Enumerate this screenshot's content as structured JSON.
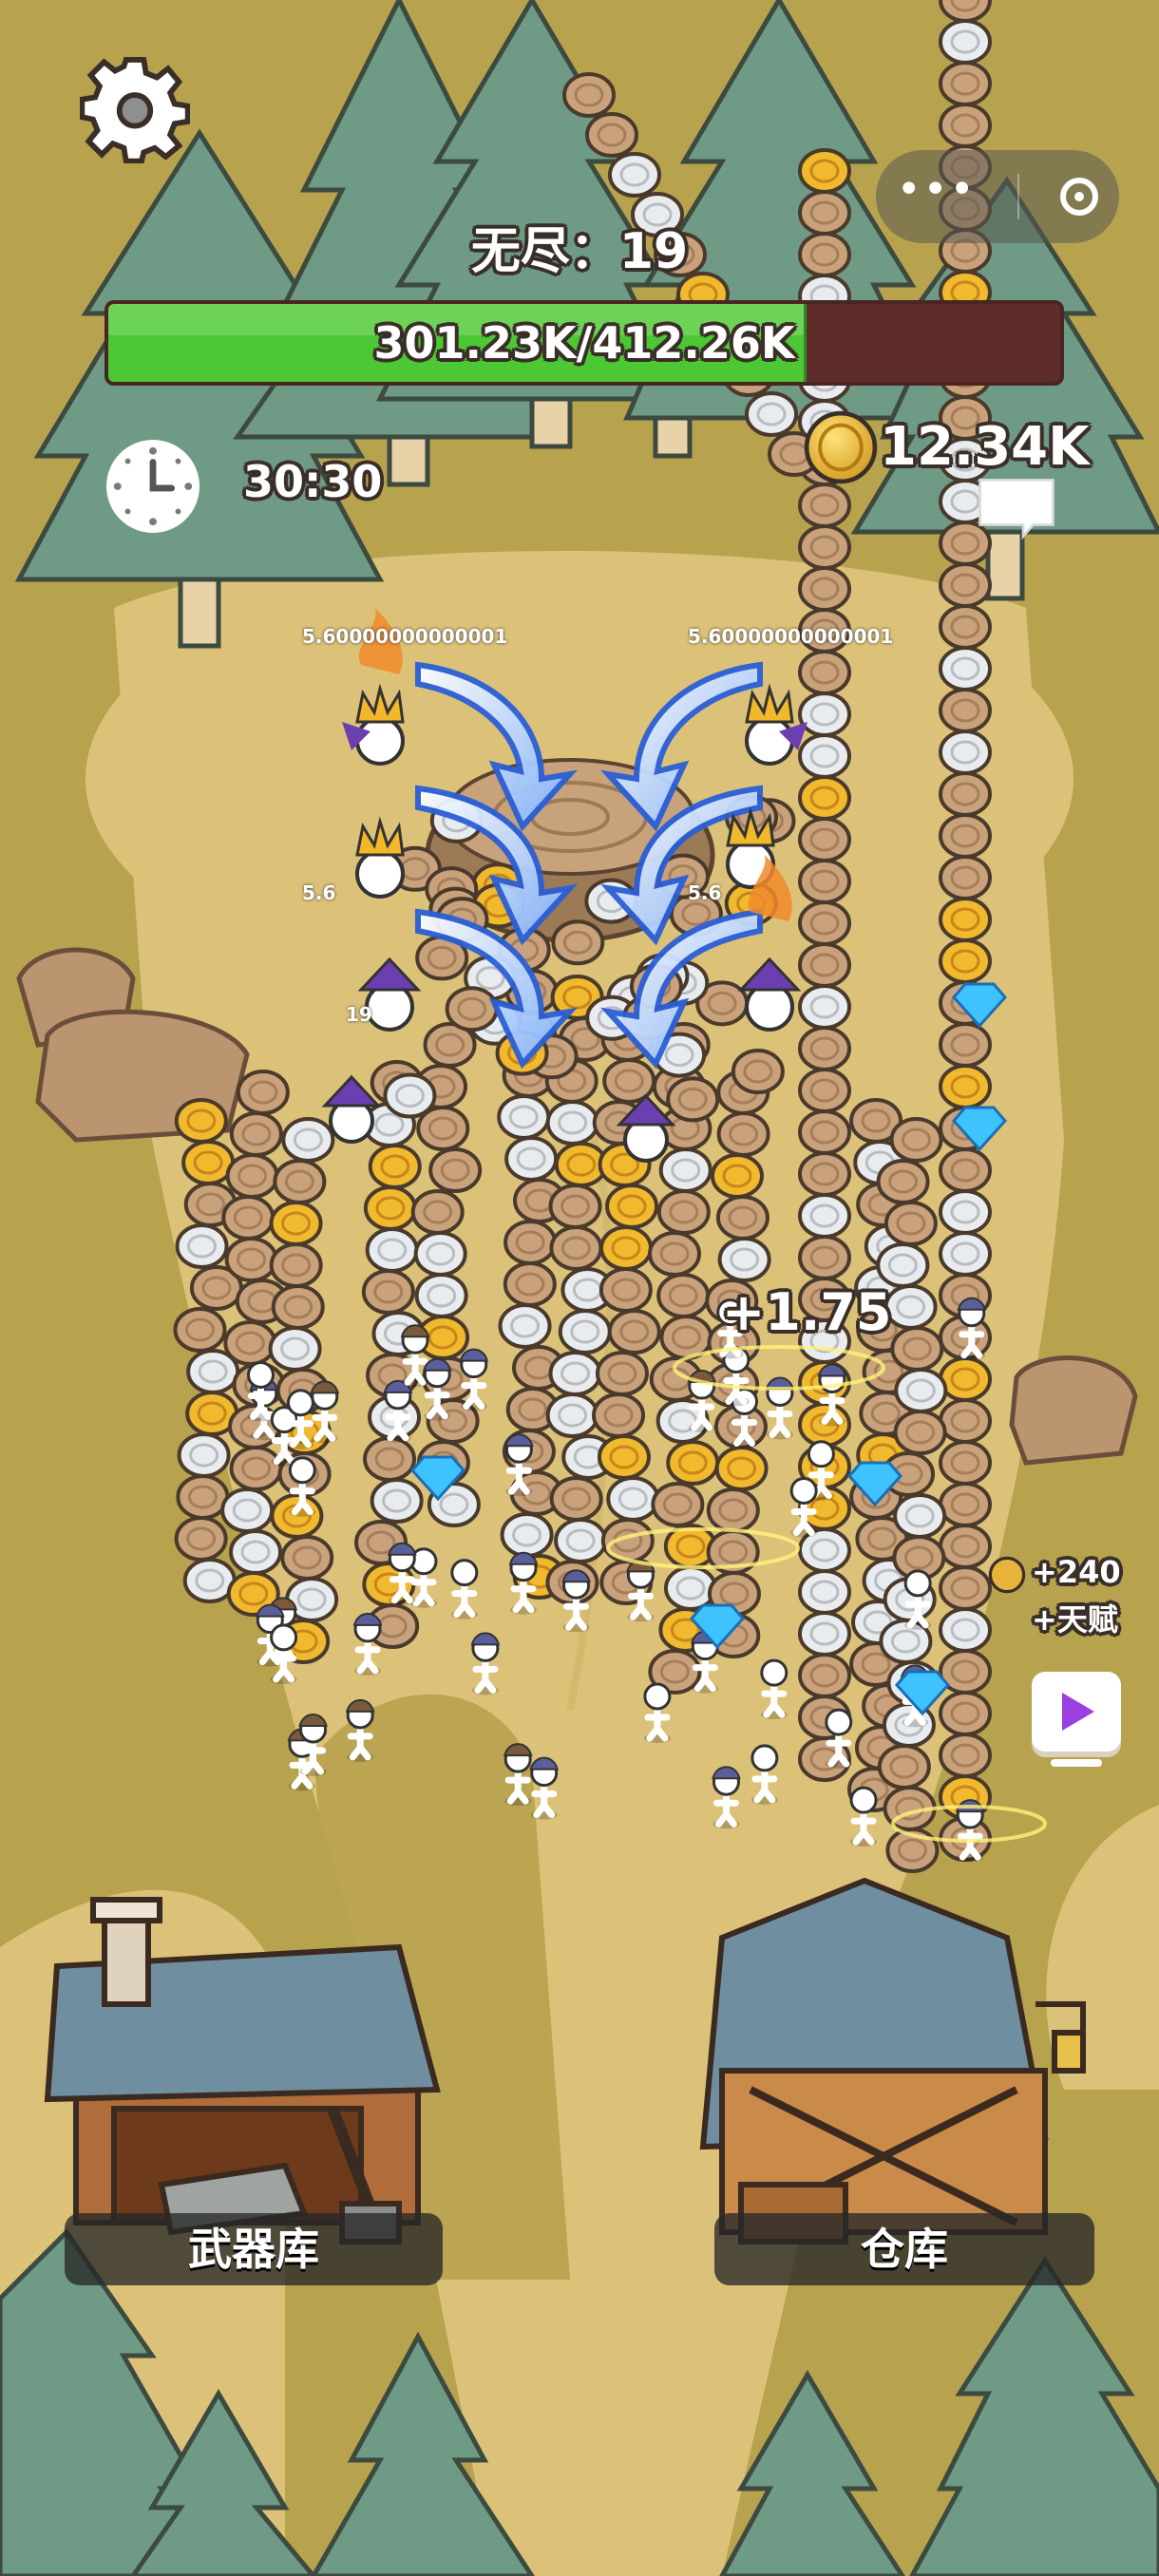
{
  "hud": {
    "endless_label": "无尽：19",
    "hp_text": "301.23K/412.26K",
    "hp_fraction": 0.7307,
    "timer": "30:30",
    "coins": "12.34K"
  },
  "battle": {
    "damage_popup": "+1.75",
    "enemy_hp_labels": [
      "5.60000000000001",
      "5.60000000000001",
      "5.6",
      "5.6",
      "19"
    ]
  },
  "side": {
    "bonus_amount": "+240",
    "bonus_talent": "+天赋"
  },
  "buildings": {
    "armory_label": "武器库",
    "warehouse_label": "仓库"
  },
  "icons": [
    "gear-icon",
    "more-icon",
    "close-target-icon",
    "clock-icon",
    "coin-icon",
    "chat-icon",
    "video-icon"
  ],
  "colors": {
    "hp_fill": "#4cc834",
    "hp_empty": "#5e2d2a",
    "ground": "#b7a24e",
    "path": "#dcc279",
    "pine": "#6e9a86"
  }
}
